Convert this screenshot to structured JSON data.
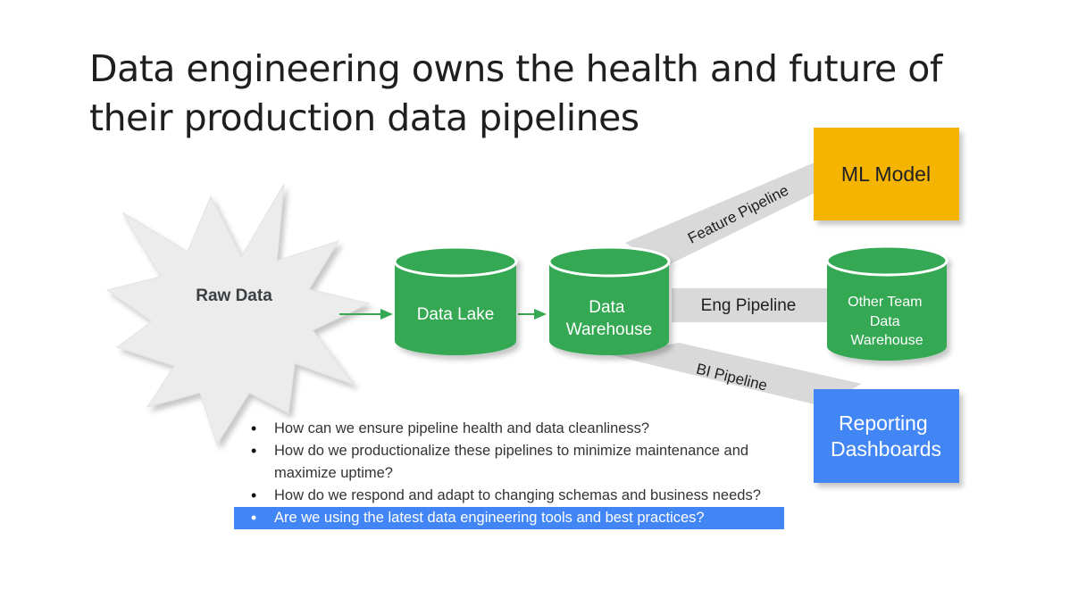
{
  "slide": {
    "title": "Data engineering owns the health and future of their production data pipelines"
  },
  "diagram": {
    "raw_data": "Raw Data",
    "data_lake": "Data Lake",
    "data_warehouse": [
      "Data",
      "Warehouse"
    ],
    "other_team_warehouse": [
      "Other Team",
      "Data",
      "Warehouse"
    ],
    "ml_model": "ML Model",
    "reporting_dashboards": [
      "Reporting",
      "Dashboards"
    ],
    "pipelines": {
      "feature": "Feature Pipeline",
      "eng": "Eng Pipeline",
      "bi": "BI Pipeline"
    },
    "colors": {
      "green": "#34a853",
      "yellow": "#f4b400",
      "blue": "#4285f4",
      "band": "#d9d9d9",
      "star": "#ececec"
    }
  },
  "bullets": [
    "How can we ensure pipeline health and data cleanliness?",
    "How do we productionalize these pipelines to minimize maintenance and maximize uptime?",
    "How do we respond and adapt to changing schemas and business needs?",
    "Are we using the latest data engineering tools and best practices?"
  ],
  "highlighted_bullet_index": 3
}
